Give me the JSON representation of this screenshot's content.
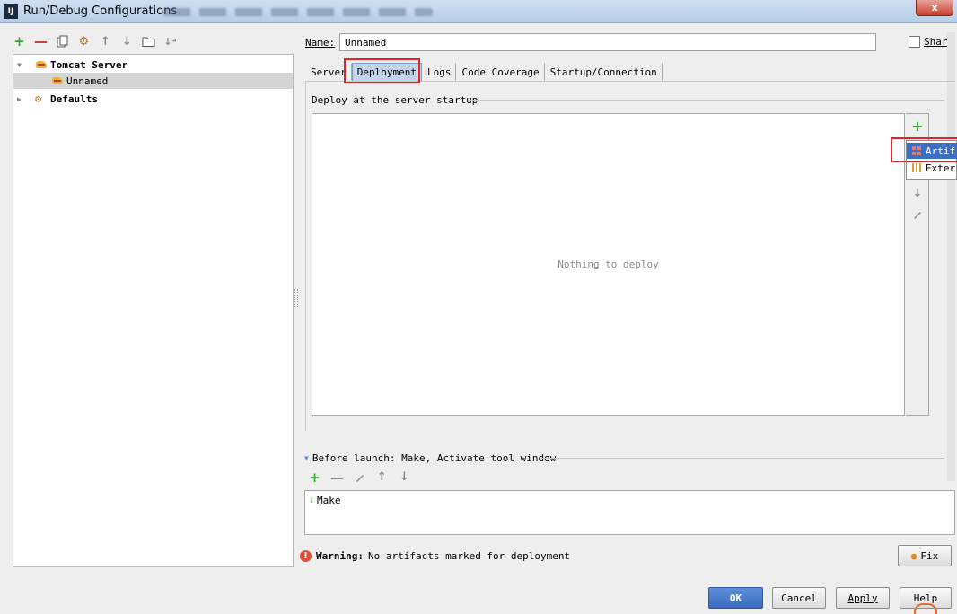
{
  "window": {
    "title": "Run/Debug Configurations",
    "app_icon_text": "IJ",
    "close_label": "x"
  },
  "left_toolbar": {
    "icons": [
      "add-icon",
      "remove-icon",
      "copy-icon",
      "edit-defaults-icon",
      "move-up-icon",
      "move-down-icon",
      "folder-icon",
      "sort-icon"
    ]
  },
  "tree": {
    "items": [
      {
        "label": "Tomcat Server",
        "icon": "tomcat-icon",
        "expanded": true,
        "bold": true
      },
      {
        "label": "Unnamed",
        "icon": "tomcat-icon",
        "selected": true
      },
      {
        "label": "Defaults",
        "icon": "defaults-icon",
        "expanded": false,
        "bold": true
      }
    ]
  },
  "name_field": {
    "label": "Name:",
    "value": "Unnamed"
  },
  "share": {
    "label": "Share",
    "checked": false
  },
  "tabs": [
    {
      "label": "Server",
      "active": false
    },
    {
      "label": "Deployment",
      "active": true
    },
    {
      "label": "Logs",
      "active": false
    },
    {
      "label": "Code Coverage",
      "active": false
    },
    {
      "label": "Startup/Connection",
      "active": false
    }
  ],
  "deployment": {
    "section_label": "Deploy at the server startup",
    "empty_text": "Nothing to deploy",
    "popup": [
      {
        "label": "Artif",
        "selected": true,
        "icon": "artifact-icon"
      },
      {
        "label": "Exter",
        "selected": false,
        "icon": "external-source-icon"
      }
    ]
  },
  "before_launch": {
    "title": "Before launch: Make, Activate tool window",
    "items": [
      {
        "label": "Make",
        "icon": "make-icon"
      }
    ]
  },
  "warning": {
    "label": "Warning:",
    "message": "No artifacts marked for deployment"
  },
  "buttons": {
    "fix": "Fix",
    "ok": "OK",
    "cancel": "Cancel",
    "apply": "Apply",
    "help": "Help"
  },
  "colors": {
    "accent": "#3c6fc4",
    "highlight_red": "#e0242b",
    "add_green": "#3aa33a"
  }
}
